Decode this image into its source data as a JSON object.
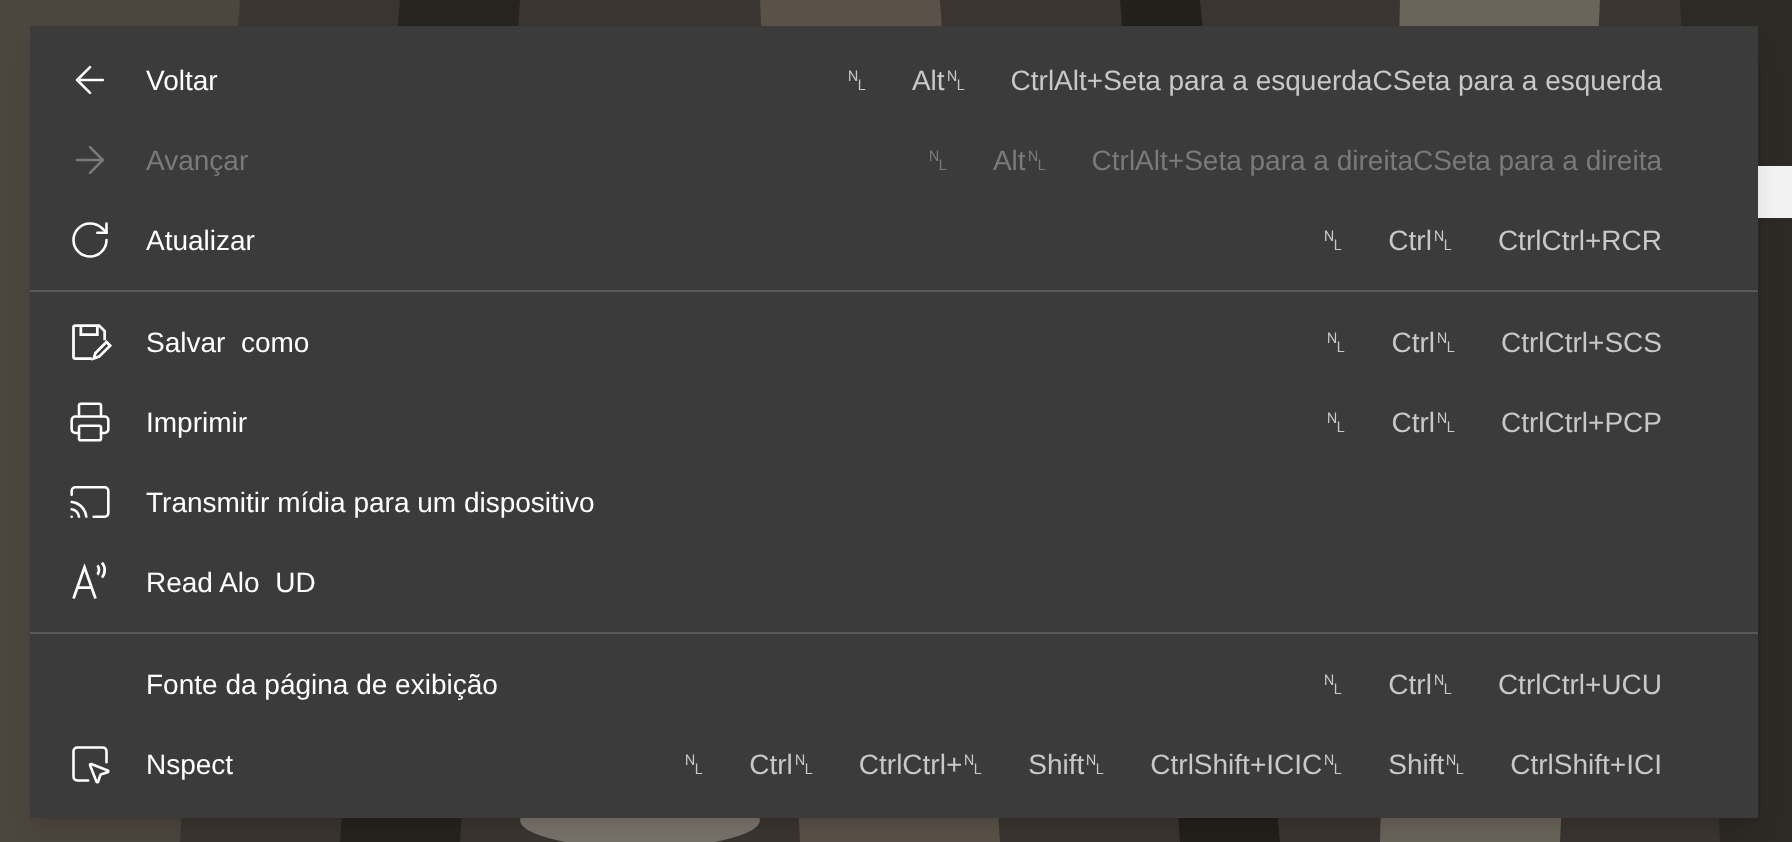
{
  "menu": {
    "groups": [
      {
        "items": [
          {
            "label": "Voltar",
            "disabled": false,
            "shortcut": [
              "␤",
              "Alt␤",
              "CtrlAlt+Seta para a esquerdaCSeta para a esquerda"
            ]
          },
          {
            "label": "Avançar",
            "disabled": true,
            "shortcut": [
              "␤",
              "Alt␤",
              "CtrlAlt+Seta para a direitaCSeta para a direita"
            ]
          },
          {
            "label": "Atualizar",
            "disabled": false,
            "shortcut": [
              "␤",
              "Ctrl␤",
              "CtrlCtrl+RCR"
            ]
          }
        ]
      },
      {
        "items": [
          {
            "label": "Salvar  como",
            "disabled": false,
            "shortcut": [
              "␤",
              "Ctrl␤",
              "CtrlCtrl+SCS"
            ]
          },
          {
            "label": "Imprimir",
            "disabled": false,
            "shortcut": [
              "␤",
              "Ctrl␤",
              "CtrlCtrl+PCP"
            ]
          },
          {
            "label": "Transmitir mídia para um dispositivo",
            "disabled": false
          },
          {
            "label": "Read Alo  UD",
            "disabled": false
          }
        ]
      },
      {
        "items": [
          {
            "label": "Fonte da página de exibição",
            "disabled": false,
            "shortcut": [
              "␤",
              "Ctrl␤",
              "CtrlCtrl+UCU"
            ]
          },
          {
            "label": "Nspect",
            "disabled": false,
            "shortcut": [
              "␤",
              "Ctrl␤",
              "CtrlCtrl+␤",
              "Shift␤",
              "CtrlShift+ICIC␤",
              "Shift␤",
              "CtrlShift+ICI"
            ]
          }
        ]
      }
    ]
  }
}
